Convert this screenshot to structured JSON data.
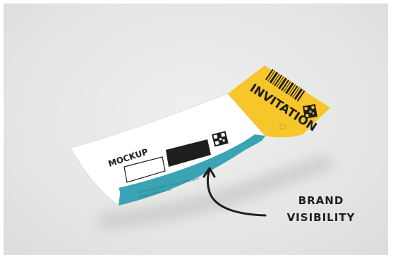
{
  "ticket": {
    "stub_word": "INVITATION",
    "main_word": "MOCKUP",
    "band_text_line1": "Lorem ipsum dolor sit amet consectetur",
    "band_text_line2": "adipiscing elit sed do"
  },
  "annotation": {
    "line1": "BRAND",
    "line2": "VISIBILITY"
  },
  "colors": {
    "background": "#e6e6e4",
    "ticket_body": "#ffffff",
    "band": "#3aa3b4",
    "stub": "#f7c62b",
    "ink": "#1e1e1e"
  }
}
